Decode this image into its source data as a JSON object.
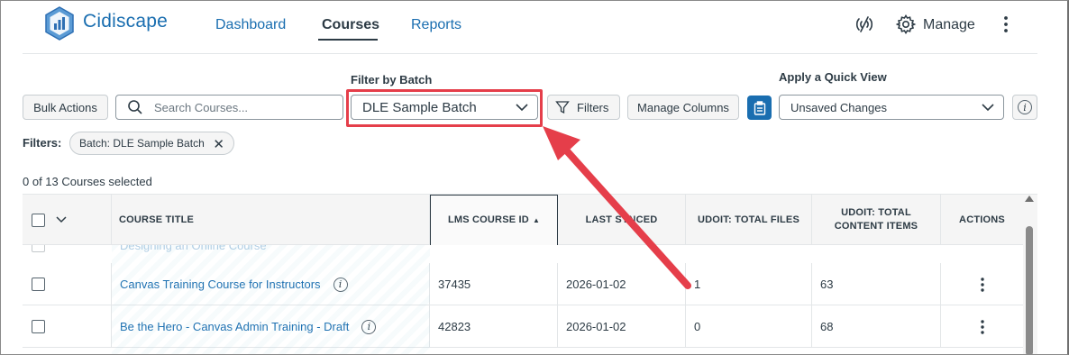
{
  "header": {
    "brand": "Cidiscape",
    "nav": [
      {
        "label": "Dashboard",
        "active": false
      },
      {
        "label": "Courses",
        "active": true
      },
      {
        "label": "Reports",
        "active": false
      }
    ],
    "manage_label": "Manage",
    "icons": [
      "offline-signal-icon",
      "gear-icon",
      "kebab-menu-icon"
    ]
  },
  "toolbar": {
    "filter_by_batch_label": "Filter by Batch",
    "bulk_actions": "Bulk Actions",
    "search_placeholder": "Search Courses...",
    "batch_selected": "DLE Sample Batch",
    "filters_button": "Filters",
    "manage_columns": "Manage Columns",
    "quick_view_label": "Apply a Quick View",
    "quick_view_selected": "Unsaved Changes"
  },
  "active_filters": {
    "label": "Filters:",
    "chips": [
      "Batch: DLE Sample Batch"
    ]
  },
  "selection_status": "0 of 13 Courses selected",
  "table": {
    "columns": [
      "COURSE TITLE",
      "LMS COURSE ID",
      "LAST SYNCED",
      "UDOIT: TOTAL FILES",
      "UDOIT: TOTAL CONTENT ITEMS",
      "ACTIONS"
    ],
    "sorted_column": "LMS COURSE ID",
    "sort_direction": "ascending",
    "partial_row_title": "Designing an Online Course",
    "rows": [
      {
        "title": "Canvas Training Course for Instructors",
        "lms_course_id": "37435",
        "last_synced": "2026-01-02",
        "total_files": "1",
        "total_content_items": "63"
      },
      {
        "title": "Be the Hero - Canvas Admin Training - Draft",
        "lms_course_id": "42823",
        "last_synced": "2026-01-02",
        "total_files": "0",
        "total_content_items": "68"
      }
    ]
  },
  "colors": {
    "brand_blue": "#1a6eb0",
    "annotation_red": "#e53e4a",
    "text_dark": "#2d3b45"
  }
}
